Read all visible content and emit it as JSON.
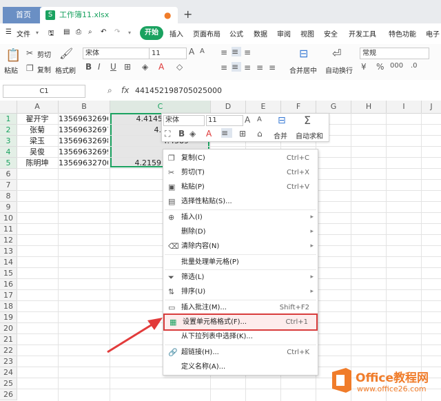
{
  "titlebar": {
    "home_tab": "首页",
    "doc_tab": "工作簿11.xlsx",
    "doc_icon": "S",
    "add_tab": "+"
  },
  "menubar": {
    "items": [
      "文件",
      "开始",
      "插入",
      "页面布局",
      "公式",
      "数据",
      "审阅",
      "视图",
      "安全",
      "开发工具",
      "特色功能",
      "电子"
    ],
    "file_icon": "hamburger-icon"
  },
  "ribbon": {
    "paste": "粘贴",
    "cut": "剪切",
    "copy": "复制",
    "format_painter": "格式刷",
    "font_name": "宋体",
    "font_size": "11",
    "merge": "合并居中",
    "wrap": "自动换行",
    "number_format": "常规"
  },
  "formula_bar": {
    "cell_ref": "C1",
    "fx": "fx",
    "value": "441452198705025000"
  },
  "columns": [
    "A",
    "B",
    "C",
    "D",
    "E",
    "F",
    "G",
    "H",
    "I",
    "J"
  ],
  "rows": [
    "1",
    "2",
    "3",
    "4",
    "5",
    "6",
    "7",
    "8",
    "9",
    "10",
    "11",
    "12",
    "13",
    "14",
    "15",
    "16",
    "17",
    "18",
    "19",
    "20",
    "21",
    "22",
    "23",
    "24",
    "25",
    "26"
  ],
  "data": [
    {
      "name": "翟开宇",
      "phone": "13569632696",
      "c": "4.4145"
    },
    {
      "name": "张菊",
      "phone": "13569632697",
      "c": "4.2583"
    },
    {
      "name": "梁玉",
      "phone": "13569632698",
      "c": "4.4589"
    },
    {
      "name": "吴俊",
      "phone": "13569632699",
      "c": "4.4369"
    },
    {
      "name": "陈明坤",
      "phone": "13569632700",
      "c": "4.2159"
    }
  ],
  "mini_toolbar": {
    "font_name": "宋体",
    "font_size": "11",
    "merge": "合并",
    "autosum": "自动求和"
  },
  "context_menu": [
    {
      "label": "复制(C)",
      "shortcut": "Ctrl+C",
      "icon": "copy-icon"
    },
    {
      "label": "剪切(T)",
      "shortcut": "Ctrl+X",
      "icon": "scissors-icon"
    },
    {
      "label": "粘贴(P)",
      "shortcut": "Ctrl+V",
      "icon": "paste-icon"
    },
    {
      "label": "选择性粘贴(S)...",
      "shortcut": "",
      "icon": "paste-special-icon"
    },
    {
      "label": "插入(I)",
      "shortcut": "",
      "icon": "insert-icon",
      "submenu": true
    },
    {
      "label": "删除(D)",
      "shortcut": "",
      "icon": "",
      "submenu": true
    },
    {
      "label": "清除内容(N)",
      "shortcut": "",
      "icon": "eraser-icon",
      "submenu": true
    },
    {
      "label": "批量处理单元格(P)",
      "shortcut": "",
      "icon": ""
    },
    {
      "label": "筛选(L)",
      "shortcut": "",
      "icon": "filter-icon",
      "submenu": true
    },
    {
      "label": "排序(U)",
      "shortcut": "",
      "icon": "sort-icon",
      "submenu": true
    },
    {
      "label": "插入批注(M)...",
      "shortcut": "Shift+F2",
      "icon": "comment-icon"
    },
    {
      "label": "设置单元格格式(F)...",
      "shortcut": "Ctrl+1",
      "icon": "format-cells-icon",
      "highlighted": true
    },
    {
      "label": "从下拉列表中选择(K)...",
      "shortcut": "",
      "icon": ""
    },
    {
      "label": "超链接(H)...",
      "shortcut": "Ctrl+K",
      "icon": "link-icon"
    },
    {
      "label": "定义名称(A)...",
      "shortcut": "",
      "icon": ""
    }
  ],
  "watermark": {
    "brand": "Office教程网",
    "url": "www.office26.com"
  },
  "colors": {
    "accent": "#1aa260",
    "highlight_border": "#d83b3b",
    "arrow": "#e23b3b",
    "watermark_orange": "#f07c2a"
  }
}
